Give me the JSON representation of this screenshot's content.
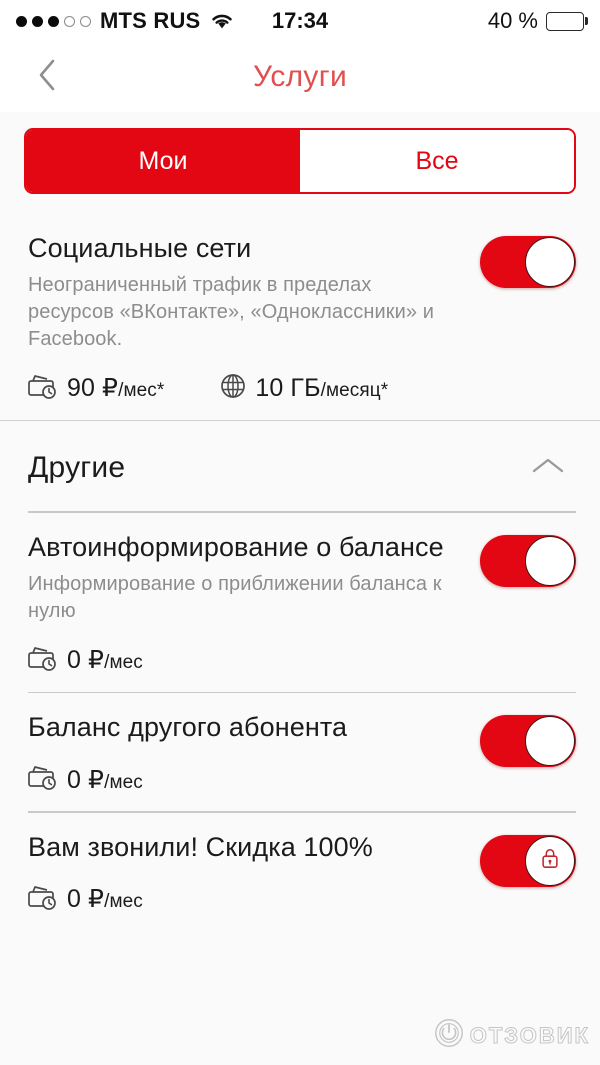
{
  "status_bar": {
    "signal_dots_filled": 3,
    "signal_dots_empty": 2,
    "carrier": "MTS RUS",
    "wifi_icon": "wifi-icon",
    "time": "17:34",
    "battery_percent_label": "40 %",
    "battery_level": 40,
    "battery_color": "#fbc900"
  },
  "navbar": {
    "back_icon": "chevron-left-icon",
    "title": "Услуги",
    "title_color": "#e05050"
  },
  "segmented_control": {
    "active_index": 0,
    "accent_color": "#e30613",
    "tabs": [
      {
        "label": "Мои",
        "active": true
      },
      {
        "label": "Все",
        "active": false
      }
    ]
  },
  "my_services": [
    {
      "title": "Социальные сети",
      "description": "Неограниченный трафик в пределах ресурсов «ВКонтакте», «Одноклассники» и Facebook.",
      "meta": [
        {
          "icon": "wallet-clock-icon",
          "value": "90 ₽",
          "unit": "/мес*"
        },
        {
          "icon": "globe-icon",
          "value": "10 ГБ",
          "unit": "/месяц*"
        }
      ],
      "toggle": {
        "state": "on",
        "locked": false
      }
    }
  ],
  "other_section": {
    "title": "Другие",
    "collapse_icon": "chevron-up-icon",
    "expanded": true,
    "services": [
      {
        "title": "Автоинформирование о балансе",
        "description": "Информирование о приближении баланса к нулю",
        "meta": [
          {
            "icon": "wallet-clock-icon",
            "value": "0 ₽",
            "unit": "/мес"
          }
        ],
        "toggle": {
          "state": "on",
          "locked": false
        }
      },
      {
        "title": "Баланс другого абонента",
        "description": "",
        "meta": [
          {
            "icon": "wallet-clock-icon",
            "value": "0 ₽",
            "unit": "/мес"
          }
        ],
        "toggle": {
          "state": "on",
          "locked": false
        }
      },
      {
        "title": "Вам звонили! Скидка 100%",
        "description": "",
        "meta": [
          {
            "icon": "wallet-clock-icon",
            "value": "0 ₽",
            "unit": "/мес"
          }
        ],
        "toggle": {
          "state": "on",
          "locked": true
        }
      }
    ]
  },
  "watermark": {
    "text": "ОТЗОВИК",
    "logo_icon": "otzovik-logo-icon"
  }
}
